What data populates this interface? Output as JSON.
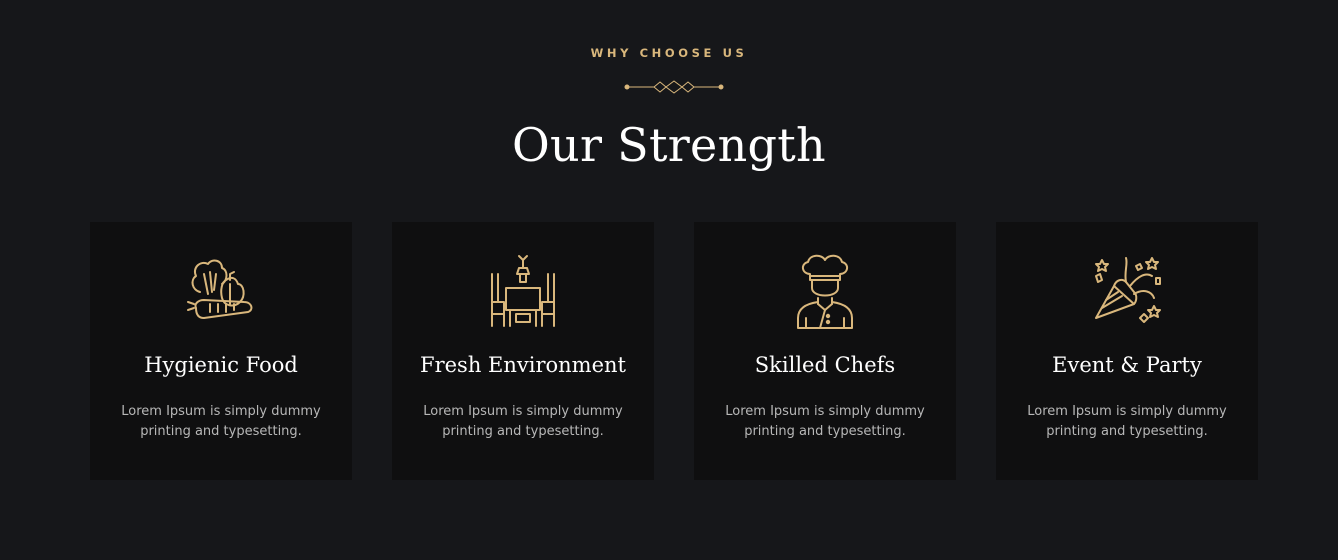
{
  "colors": {
    "accent": "#d9b77c",
    "background": "#16171a",
    "card": "#0f0f10",
    "text_muted": "#b7b7b7"
  },
  "section": {
    "eyebrow": "WHY CHOOSE US",
    "divider_icon": "ornament-divider-icon",
    "title": "Our Strength"
  },
  "cards": [
    {
      "icon": "vegetables-icon",
      "title": "Hygienic Food",
      "description": "Lorem Ipsum is simply dummy printing and typesetting."
    },
    {
      "icon": "dining-table-icon",
      "title": "Fresh Environment",
      "description": "Lorem Ipsum is simply dummy printing and typesetting."
    },
    {
      "icon": "chef-icon",
      "title": "Skilled Chefs",
      "description": "Lorem Ipsum is simply dummy printing and typesetting."
    },
    {
      "icon": "party-popper-icon",
      "title": "Event & Party",
      "description": "Lorem Ipsum is simply dummy printing and typesetting."
    }
  ]
}
